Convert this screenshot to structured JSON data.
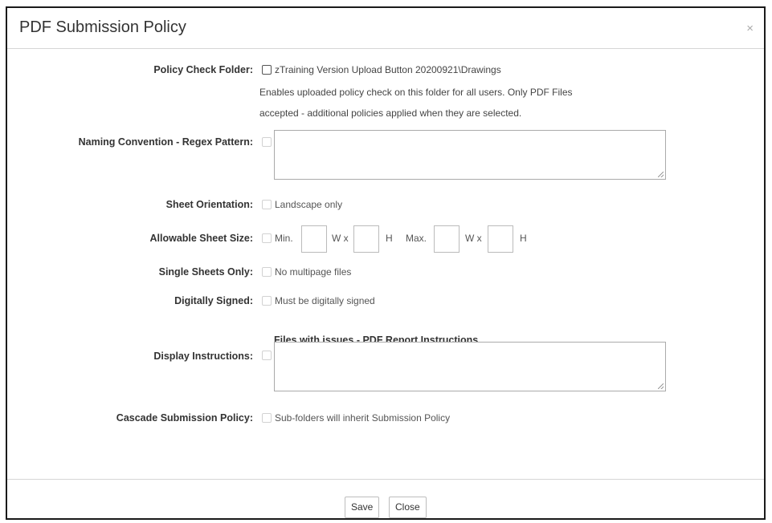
{
  "dialog": {
    "title": "PDF Submission Policy",
    "close_glyph": "×"
  },
  "policy_check_folder": {
    "label": "Policy Check Folder:",
    "folder_path": "zTraining Version Upload Button 20200921\\Drawings",
    "description_line1": "Enables uploaded policy check on this folder for all users. Only PDF Files",
    "description_line2": "accepted - additional policies applied when they are selected."
  },
  "naming_convention": {
    "label": "Naming Convention - Regex Pattern:",
    "value": ""
  },
  "sheet_orientation": {
    "label": "Sheet Orientation:",
    "option_text": "Landscape only"
  },
  "allowable_sheet_size": {
    "label": "Allowable Sheet Size:",
    "min_label": "Min.",
    "width_label": "W x",
    "height_label": "H",
    "max_label": "Max.",
    "min_width": "",
    "min_height": "",
    "max_width": "",
    "max_height": ""
  },
  "single_sheets": {
    "label": "Single Sheets Only:",
    "option_text": "No multipage files"
  },
  "digitally_signed": {
    "label": "Digitally Signed:",
    "option_text": "Must be digitally signed"
  },
  "display_instructions": {
    "heading": "Files with issues - PDF Report Instructions",
    "label": "Display Instructions:",
    "value": ""
  },
  "cascade": {
    "label": "Cascade Submission Policy:",
    "option_text": "Sub-folders will inherit Submission Policy"
  },
  "footer": {
    "save_label": "Save",
    "close_label": "Close"
  },
  "icons": {
    "close": "close-icon",
    "resize_grip": "resize-grip-icon"
  }
}
